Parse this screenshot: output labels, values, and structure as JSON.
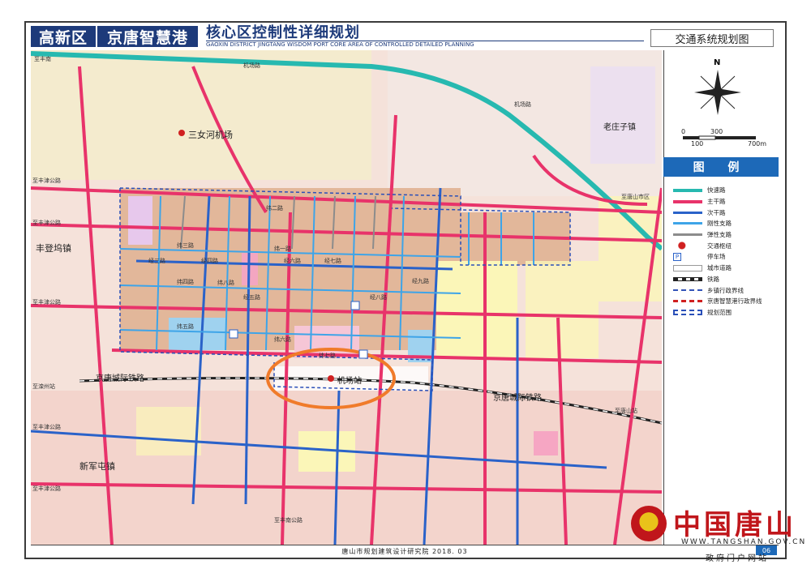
{
  "header": {
    "district": "高新区",
    "project": "京唐智慧港",
    "title": "核心区控制性详细规划",
    "title_en": "GAOXIN DISTRICT JINGTANG WISDOM PORT CORE AREA OF CONTROLLED DETAILED PLANNING",
    "sheet_name": "交通系统规划图"
  },
  "map_labels": {
    "airport": "三女河机场",
    "laozhuangzi": "老庄子镇",
    "fengdengwu": "丰登坞镇",
    "xinjuntun": "新军屯镇",
    "rail_west": "京唐城际铁路",
    "rail_east": "京唐城际铁路",
    "airport_station": "机场站",
    "jichang_road_top": "机场路",
    "jichang_road_diag": "机场路",
    "zhifeng_top": "至丰南",
    "zhifeng_west1": "至丰津公路",
    "zhifeng_west2": "至丰津公路",
    "zhifeng_west3": "至丰津公路",
    "zhifeng_west4": "至丰津公路",
    "zhifeng_west5": "至丰津公路",
    "zhiqianzhou": "至滦州站",
    "zhitangshan": "至唐山站",
    "zhifengnan_bottom": "至丰南公路",
    "zhiqi": "至唐山市区"
  },
  "road_labels": [
    "纬三路",
    "纬四路",
    "纬五路",
    "纬六路",
    "纬七路",
    "纬八路",
    "纬二路",
    "纬一路",
    "经三路",
    "经四路",
    "经五路",
    "经六路",
    "经七路",
    "经八路",
    "经九路"
  ],
  "scale": {
    "north": "N",
    "ticks_top": [
      "0",
      "300"
    ],
    "ticks_bottom": [
      "100",
      "700m"
    ]
  },
  "legend": {
    "title": "图 例",
    "items": [
      {
        "label": "快速路",
        "color": "#27b9b0",
        "style": "solid"
      },
      {
        "label": "主干路",
        "color": "#e8336a",
        "style": "solid"
      },
      {
        "label": "次干路",
        "color": "#2a62c9",
        "style": "solid"
      },
      {
        "label": "刚性支路",
        "color": "#3ea4e8",
        "style": "solid"
      },
      {
        "label": "弹性支路",
        "color": "#8c8c8c",
        "style": "solid"
      },
      {
        "label": "交通枢纽",
        "color": "#d02020",
        "style": "hub"
      },
      {
        "label": "停车场",
        "color": "#2a62c9",
        "style": "parking"
      },
      {
        "label": "城市道路",
        "color": "#ffffff",
        "style": "outline"
      },
      {
        "label": "铁路",
        "color": "#222222",
        "style": "rail"
      },
      {
        "label": "乡镇行政界线",
        "color": "#3353b8",
        "style": "dash"
      },
      {
        "label": "京唐智慧港行政界线",
        "color": "#d02020",
        "style": "dashred"
      },
      {
        "label": "规划范围",
        "color": "#2a4fb8",
        "style": "boundary"
      }
    ]
  },
  "footer": {
    "institute": "唐山市规划建筑设计研究院  2018. 03",
    "page": "06"
  },
  "watermark": {
    "name": "中国唐山",
    "url": "WWW.TANGSHAN.GOV.CN",
    "portal": "政府门户网站"
  },
  "colors": {
    "frame": "#1d3a7a",
    "accent": "#1d69b8",
    "arterial": "#e8336a",
    "secondary": "#2a62c9",
    "expressway": "#27b9b0",
    "highlight_circle": "#f07b2a"
  }
}
